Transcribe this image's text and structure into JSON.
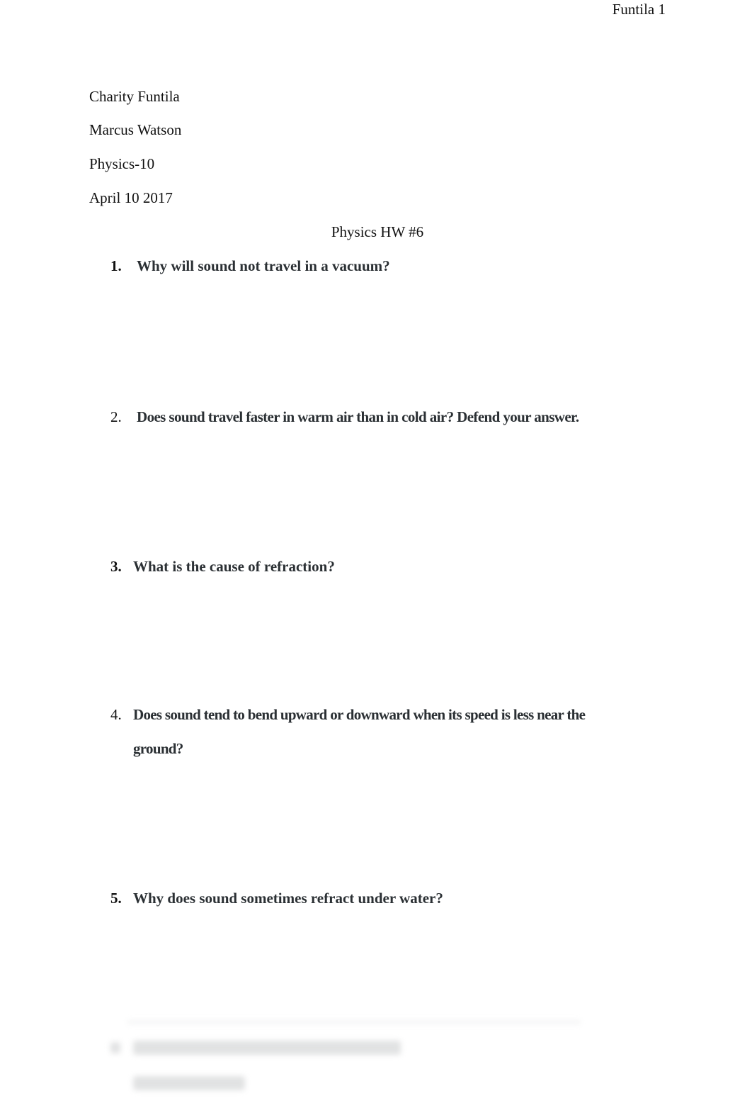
{
  "header": {
    "running_head": "Funtila 1"
  },
  "meta": {
    "student": "Charity Funtila",
    "instructor": "Marcus Watson",
    "course": "Physics-10",
    "date": "April 10 2017"
  },
  "title": "Physics HW #6",
  "questions": [
    {
      "number": "1.",
      "text": "Why will sound not travel in a vacuum?"
    },
    {
      "number": "2.",
      "text": "Does sound travel faster in warm air than in cold air? Defend your answer."
    },
    {
      "number": "3.",
      "text": "What is the cause of refraction?"
    },
    {
      "number": "4.",
      "text": "Does sound tend to bend upward or downward when its speed is less near the",
      "text_cont": "ground?"
    },
    {
      "number": "5.",
      "text": "Why does sound sometimes refract under water?"
    }
  ],
  "blurred_preview": {
    "note": "obscured content"
  }
}
